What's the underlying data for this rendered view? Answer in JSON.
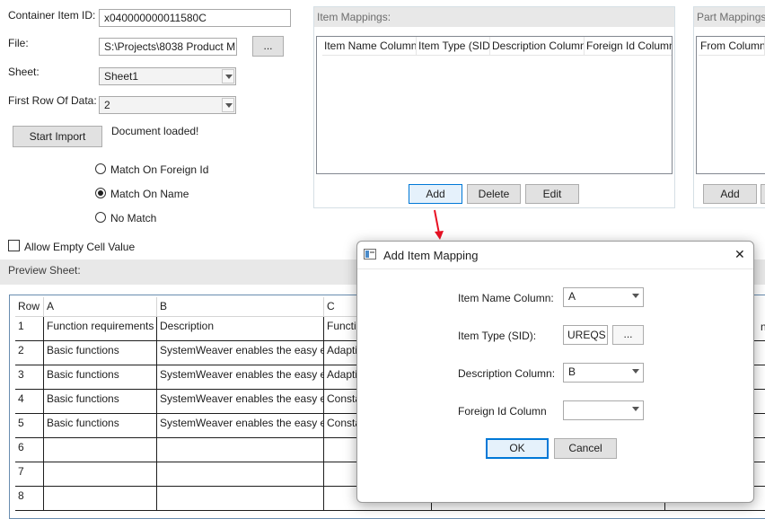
{
  "form": {
    "container_label": "Container Item ID:",
    "container_value": "x040000000011580C",
    "file_label": "File:",
    "file_value": "S:\\Projects\\8038 Product M",
    "browse_label": "...",
    "sheet_label": "Sheet:",
    "sheet_value": "Sheet1",
    "first_row_label": "First Row Of Data:",
    "first_row_value": "2",
    "start_import_label": "Start Import",
    "status_text": "Document loaded!",
    "match_foreign": "Match On Foreign Id",
    "match_name": "Match On Name",
    "no_match": "No Match",
    "allow_empty": "Allow Empty Cell Value"
  },
  "item_mappings": {
    "title": "Item Mappings:",
    "columns": [
      "Item Name Column",
      "Item Type (SID)",
      "Description Column",
      "Foreign Id Column"
    ],
    "add": "Add",
    "delete": "Delete",
    "edit": "Edit"
  },
  "part_mappings": {
    "title": "Part Mappings:",
    "columns": [
      "From Column"
    ],
    "add": "Add"
  },
  "preview": {
    "title": "Preview Sheet:",
    "headers": [
      "Row",
      "A",
      "B",
      "C"
    ],
    "rows": [
      [
        "1",
        "Function requirements",
        "Description",
        "Functi"
      ],
      [
        "2",
        "Basic functions",
        "SystemWeaver enables the easy e",
        "Adapti"
      ],
      [
        "3",
        "Basic functions",
        "SystemWeaver enables the easy e",
        "Adapti"
      ],
      [
        "4",
        "Basic functions",
        "SystemWeaver enables the easy e",
        "Consta"
      ],
      [
        "5",
        "Basic functions",
        "SystemWeaver enables the easy e",
        "Consta"
      ],
      [
        "6",
        "",
        "",
        ""
      ],
      [
        "7",
        "",
        "",
        ""
      ],
      [
        "8",
        "",
        "",
        ""
      ]
    ],
    "right_fragment": "ne"
  },
  "dialog": {
    "title": "Add Item Mapping",
    "close_glyph": "✕",
    "item_name_label": "Item Name Column:",
    "item_name_value": "A",
    "item_type_label": "Item Type (SID):",
    "item_type_value": "UREQS",
    "item_type_browse": "...",
    "description_label": "Description Column:",
    "description_value": "B",
    "foreign_label": "Foreign Id Column",
    "foreign_value": "",
    "ok": "OK",
    "cancel": "Cancel"
  },
  "colors": {
    "annotation_arrow": "#e81123",
    "default_button_border": "#0078d7",
    "group_header_bg": "#e8e8e8"
  }
}
